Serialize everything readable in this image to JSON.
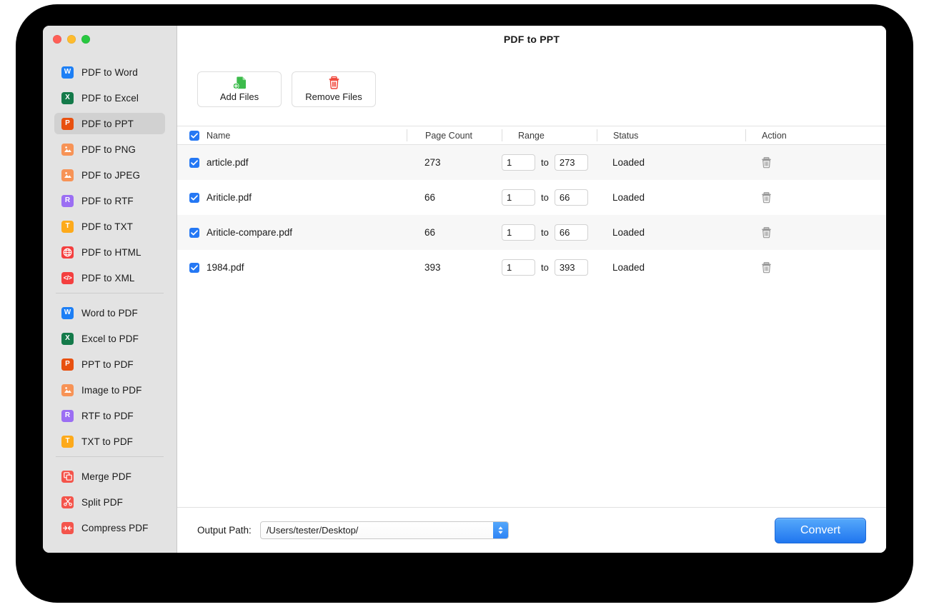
{
  "window": {
    "title": "PDF to PPT",
    "traffic_lights": [
      "close",
      "minimize",
      "zoom"
    ]
  },
  "sidebar": {
    "groups": [
      {
        "items": [
          {
            "label": "PDF to Word",
            "icon": "word-icon",
            "color": "#1d7ff5",
            "glyph": "W",
            "active": false
          },
          {
            "label": "PDF to Excel",
            "icon": "excel-icon",
            "color": "#147a4a",
            "glyph": "X",
            "active": false
          },
          {
            "label": "PDF to PPT",
            "icon": "ppt-icon",
            "color": "#e8500f",
            "glyph": "P",
            "active": true
          },
          {
            "label": "PDF to PNG",
            "icon": "png-icon",
            "color": "#f79356",
            "glyph": "IMG",
            "active": false
          },
          {
            "label": "PDF to JPEG",
            "icon": "jpeg-icon",
            "color": "#f79356",
            "glyph": "IMG",
            "active": false
          },
          {
            "label": "PDF to RTF",
            "icon": "rtf-icon",
            "color": "#9b6ef3",
            "glyph": "R",
            "active": false
          },
          {
            "label": "PDF to TXT",
            "icon": "txt-icon",
            "color": "#fdaa1b",
            "glyph": "T",
            "active": false
          },
          {
            "label": "PDF to HTML",
            "icon": "html-icon",
            "color": "#f43f3f",
            "glyph": "GLOBE",
            "active": false
          },
          {
            "label": "PDF to XML",
            "icon": "xml-icon",
            "color": "#f43f3f",
            "glyph": "CODE",
            "active": false
          }
        ]
      },
      {
        "items": [
          {
            "label": "Word to PDF",
            "icon": "word-icon",
            "color": "#1d7ff5",
            "glyph": "W",
            "active": false
          },
          {
            "label": "Excel to PDF",
            "icon": "excel-icon",
            "color": "#147a4a",
            "glyph": "X",
            "active": false
          },
          {
            "label": "PPT to PDF",
            "icon": "ppt-icon",
            "color": "#e8500f",
            "glyph": "P",
            "active": false
          },
          {
            "label": "Image to PDF",
            "icon": "image-icon",
            "color": "#f79356",
            "glyph": "IMG",
            "active": false
          },
          {
            "label": "RTF to PDF",
            "icon": "rtf-icon",
            "color": "#9b6ef3",
            "glyph": "R",
            "active": false
          },
          {
            "label": "TXT to PDF",
            "icon": "txt-icon",
            "color": "#fdaa1b",
            "glyph": "T",
            "active": false
          }
        ]
      },
      {
        "items": [
          {
            "label": "Merge PDF",
            "icon": "merge-icon",
            "color": "#f4544b",
            "glyph": "MERGE",
            "active": false
          },
          {
            "label": "Split PDF",
            "icon": "split-icon",
            "color": "#f4544b",
            "glyph": "SCISSORS",
            "active": false
          },
          {
            "label": "Compress PDF",
            "icon": "compress-icon",
            "color": "#f4544b",
            "glyph": "ARROWS",
            "active": false
          }
        ]
      }
    ]
  },
  "toolbar": {
    "add_files_label": "Add Files",
    "add_files_icon": "add-document-icon",
    "remove_files_label": "Remove Files",
    "remove_files_icon": "trash-icon"
  },
  "table": {
    "select_all_checked": true,
    "columns": [
      "Name",
      "Page Count",
      "Range",
      "Status",
      "Action"
    ],
    "range_separator": "to",
    "row_action_icon": "trash-icon",
    "rows": [
      {
        "checked": true,
        "name": "article.pdf",
        "page_count": "273",
        "range_from": "1",
        "range_to": "273",
        "status": "Loaded"
      },
      {
        "checked": true,
        "name": "Ariticle.pdf",
        "page_count": "66",
        "range_from": "1",
        "range_to": "66",
        "status": "Loaded"
      },
      {
        "checked": true,
        "name": "Ariticle-compare.pdf",
        "page_count": "66",
        "range_from": "1",
        "range_to": "66",
        "status": "Loaded"
      },
      {
        "checked": true,
        "name": "1984.pdf",
        "page_count": "393",
        "range_from": "1",
        "range_to": "393",
        "status": "Loaded"
      }
    ]
  },
  "bottom": {
    "output_path_label": "Output Path:",
    "output_path_value": "/Users/tester/Desktop/",
    "stepper_icon": "updown-chevrons-icon",
    "convert_label": "Convert"
  },
  "colors": {
    "accent_blue": "#2578f4",
    "sidebar_bg": "#e3e3e3",
    "active_item_bg": "#d1d1d1",
    "row_alt_bg": "#f7f7f7",
    "add_green": "#3cbb4b",
    "remove_red": "#f04438"
  }
}
